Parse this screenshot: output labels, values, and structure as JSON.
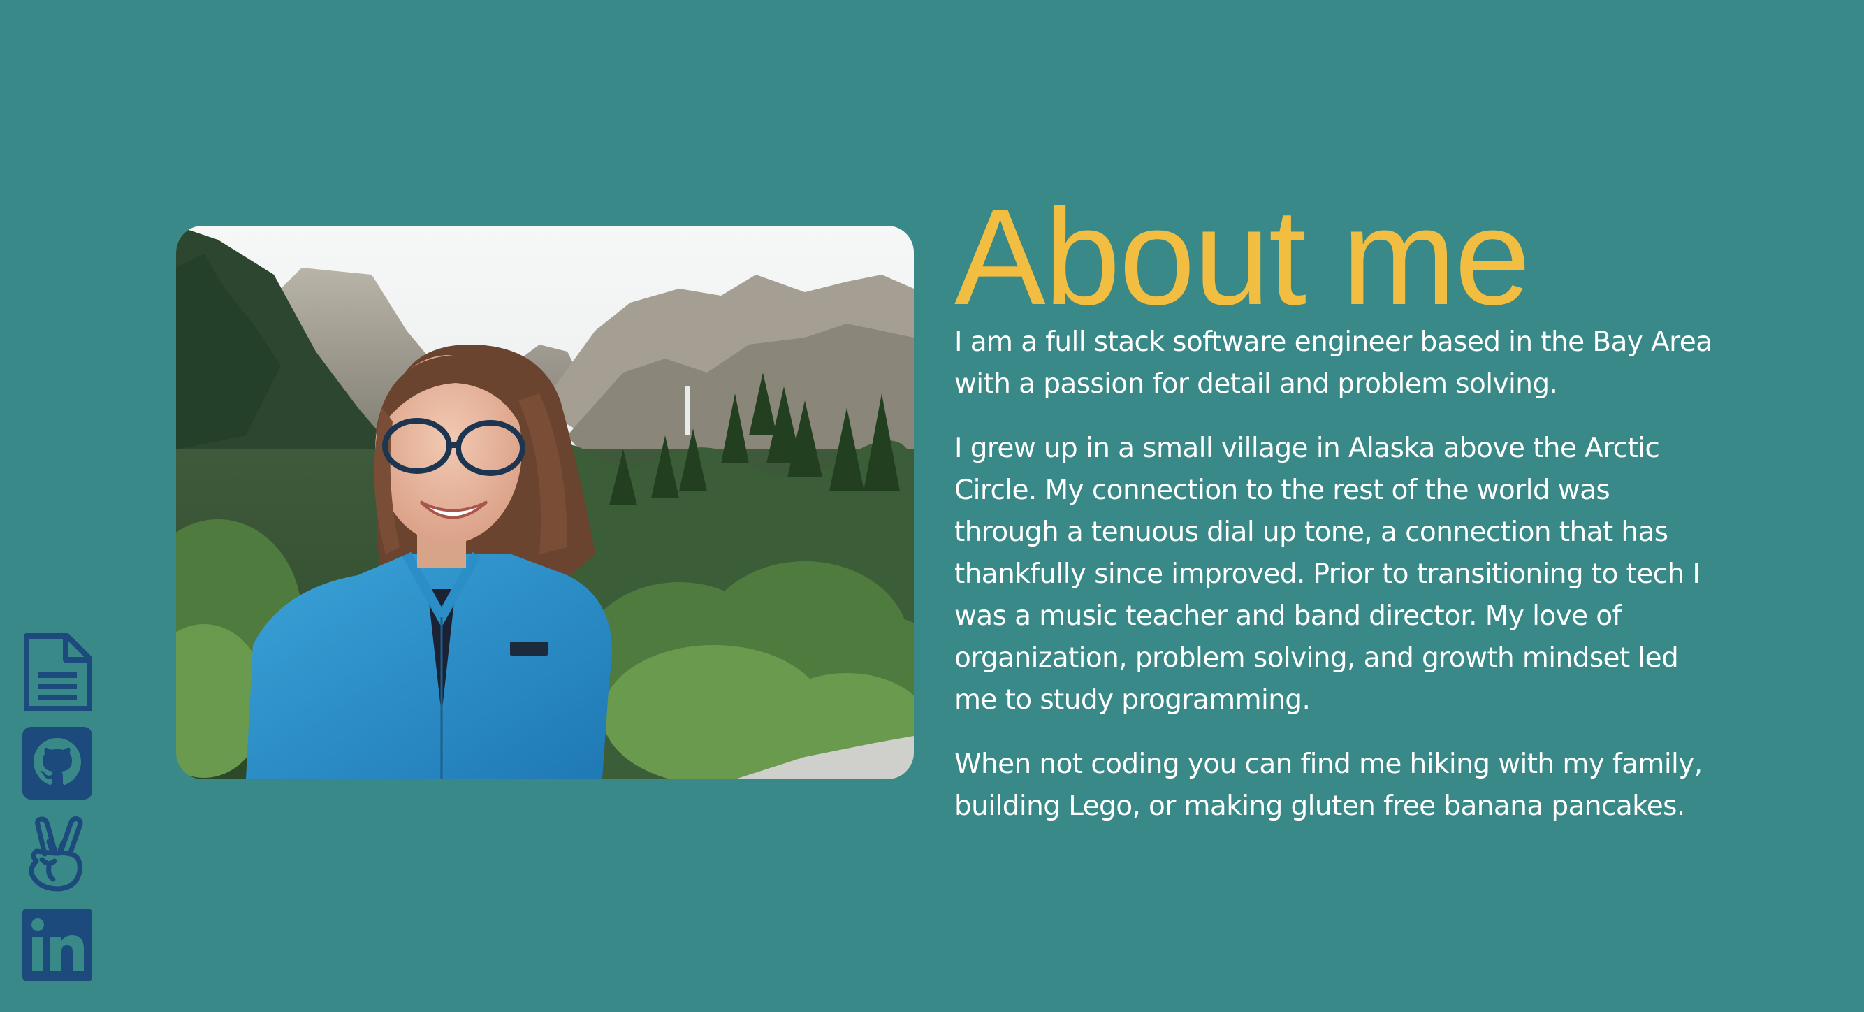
{
  "about": {
    "title": "About me",
    "paragraphs": [
      "I am a full stack software engineer based in the Bay Area with a passion for detail and problem solving.",
      "I grew up in a small village in Alaska above the Arctic Circle. My connection to the rest of the world was through a tenuous dial up tone, a connection that has thankfully since improved. Prior to transitioning to tech I was a music teacher and band director. My love of organization, problem solving, and growth mindset led me to study programming.",
      "When not coding you can find me hiking with my family, building Lego, or making gluten free banana pancakes."
    ]
  },
  "photo": {
    "description_icon": "portrait-photo"
  },
  "social_links": [
    {
      "icon": "resume-document-icon"
    },
    {
      "icon": "github-icon"
    },
    {
      "icon": "angellist-icon"
    },
    {
      "icon": "linkedin-icon"
    }
  ],
  "colors": {
    "background": "#398988",
    "accent": "#f2be42",
    "text": "#ffffff",
    "icon": "#1d4a7c"
  }
}
